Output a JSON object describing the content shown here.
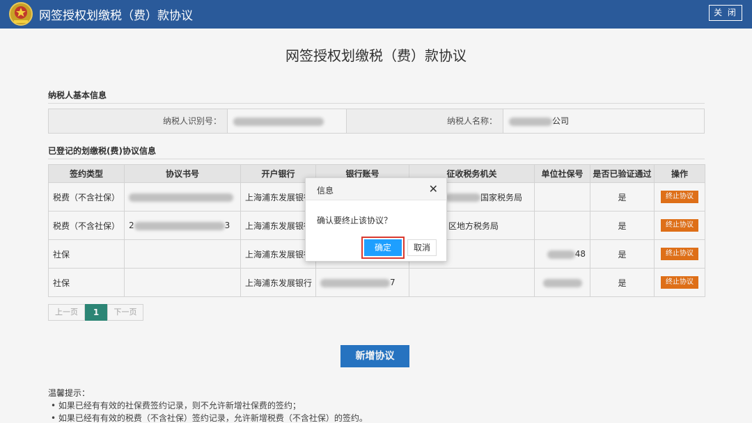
{
  "header": {
    "app_title": "网签授权划缴税（费）款协议",
    "close_label": "关 闭"
  },
  "page": {
    "title": "网签授权划缴税（费）款协议"
  },
  "basic_info": {
    "section_title": "纳税人基本信息",
    "id_label": "纳税人识别号：",
    "name_label": "纳税人名称：",
    "name_suffix": "公司"
  },
  "agreements": {
    "section_title": "已登记的划缴税(费)协议信息",
    "columns": [
      "签约类型",
      "协议书号",
      "开户银行",
      "银行账号",
      "征收税务机关",
      "单位社保号",
      "是否已验证通过",
      "操作"
    ],
    "rows": [
      {
        "type": "税费（不含社保）",
        "bank": "上海浦东发展银行",
        "tax_office": "国家税务局",
        "social_no": "",
        "verified": "是",
        "action": "终止协议"
      },
      {
        "type": "税费（不含社保）",
        "bank": "上海浦东发展银行",
        "tax_office": "区地方税务局",
        "social_no": "",
        "verified": "是",
        "action": "终止协议"
      },
      {
        "type": "社保",
        "bank": "上海浦东发展银行",
        "tax_office": "",
        "social_no": "48",
        "verified": "是",
        "action": "终止协议"
      },
      {
        "type": "社保",
        "bank": "上海浦东发展银行",
        "tax_office": "",
        "account_suffix": "7",
        "social_no": "",
        "verified": "是",
        "action": "终止协议"
      }
    ],
    "row1_id_suffix": "3",
    "row0_id_prefix": "2"
  },
  "pager": {
    "prev": "上一页",
    "current": "1",
    "next": "下一页"
  },
  "add_button": "新增协议",
  "tips": {
    "title": "温馨提示：",
    "items": [
      "如果已经有有效的社保费签约记录，则不允许新增社保费的签约；",
      "如果已经有有效的税费（不含社保）签约记录，允许新增税费（不含社保）的签约。"
    ]
  },
  "dialog": {
    "title": "信息",
    "message": "确认要终止该协议？",
    "confirm": "确定",
    "cancel": "取消"
  },
  "colors": {
    "header": "#2a5a9a",
    "terminate": "#e8741a",
    "confirm": "#1e9fff",
    "highlight": "#d9392f",
    "add": "#2878c8",
    "pager_active": "#2e8b7a"
  }
}
